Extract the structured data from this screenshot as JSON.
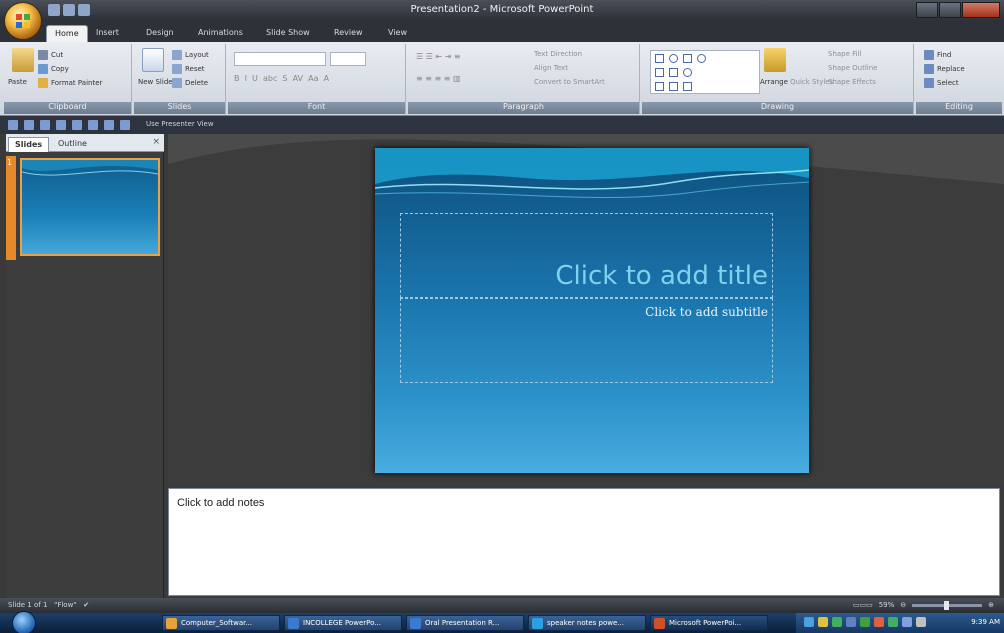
{
  "window": {
    "title": "Presentation2 - Microsoft PowerPoint"
  },
  "tabs": [
    "Home",
    "Insert",
    "Design",
    "Animations",
    "Slide Show",
    "Review",
    "View"
  ],
  "ribbon": {
    "clipboard": {
      "label": "Clipboard",
      "paste": "Paste",
      "cut": "Cut",
      "copy": "Copy",
      "format_painter": "Format Painter"
    },
    "slides": {
      "label": "Slides",
      "new_slide": "New Slide",
      "layout": "Layout",
      "reset": "Reset",
      "delete": "Delete"
    },
    "font": {
      "label": "Font"
    },
    "paragraph": {
      "label": "Paragraph",
      "text_direction": "Text Direction",
      "align_text": "Align Text",
      "convert_smartart": "Convert to SmartArt"
    },
    "drawing": {
      "label": "Drawing",
      "arrange": "Arrange",
      "quick_styles": "Quick Styles",
      "shape_fill": "Shape Fill",
      "shape_outline": "Shape Outline",
      "shape_effects": "Shape Effects"
    },
    "editing": {
      "label": "Editing",
      "find": "Find",
      "replace": "Replace",
      "select": "Select"
    }
  },
  "subbar": {
    "presenter_view": "Use Presenter View"
  },
  "left_panel": {
    "tabs": [
      "Slides",
      "Outline"
    ],
    "close": "×",
    "slide_number": "1"
  },
  "slide": {
    "title_placeholder": "Click to add title",
    "subtitle_placeholder": "Click to add subtitle"
  },
  "notes": {
    "placeholder": "Click to add notes"
  },
  "status": {
    "slide_info": "Slide 1 of 1",
    "theme": "\"Flow\"",
    "zoom": "59%"
  },
  "taskbar": {
    "items": [
      {
        "label": "Computer_Softwar...",
        "color": "#e6a33a"
      },
      {
        "label": "INCOLLEGE PowerPo...",
        "color": "#3a7ad0"
      },
      {
        "label": "Oral Presentation R...",
        "color": "#3a7ad0"
      },
      {
        "label": "speaker notes powe...",
        "color": "#2aa0e0"
      },
      {
        "label": "Microsoft PowerPoi...",
        "color": "#d0502a"
      }
    ],
    "clock": "9:39 AM"
  }
}
